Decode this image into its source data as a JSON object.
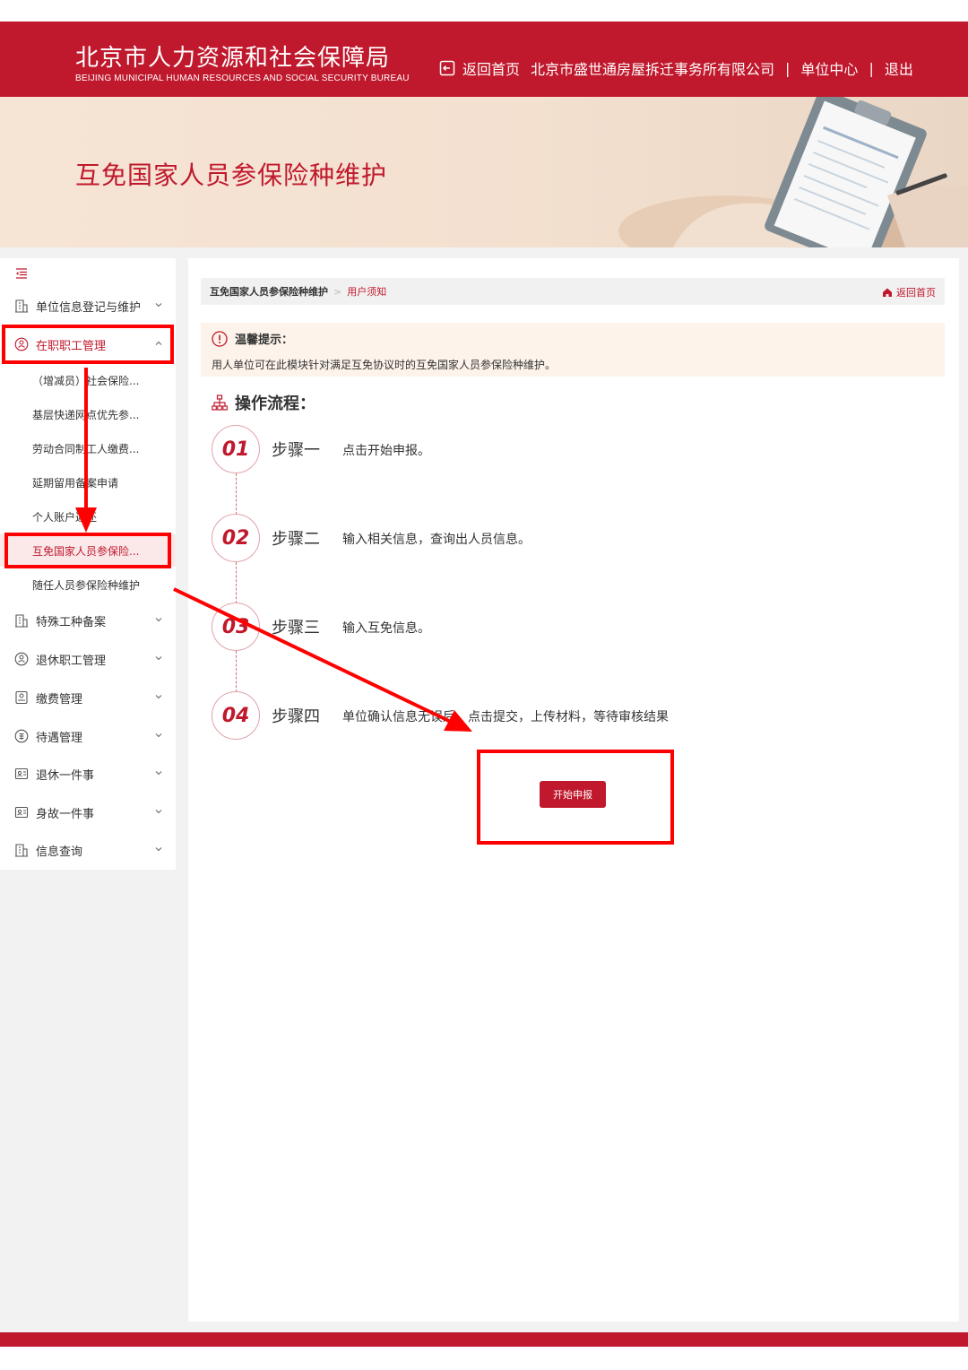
{
  "header": {
    "title": "北京市人力资源和社会保障局",
    "subtitle": "BEIJING MUNICIPAL HUMAN RESOURCES AND SOCIAL SECURITY BUREAU",
    "nav": {
      "home": "返回首页",
      "company": "北京市盛世通房屋拆迁事务所有限公司",
      "separator": "|",
      "unit_center": "单位中心",
      "logout": "退出"
    }
  },
  "banner": {
    "page_title": "互免国家人员参保险种维护"
  },
  "sidebar": {
    "menu": [
      {
        "label": "单位信息登记与维护"
      },
      {
        "label": "在职职工管理"
      },
      {
        "label": "特殊工种备案"
      },
      {
        "label": "退休职工管理"
      },
      {
        "label": "缴费管理"
      },
      {
        "label": "待遇管理"
      },
      {
        "label": "退休一件事"
      },
      {
        "label": "身故一件事"
      },
      {
        "label": "信息查询"
      }
    ],
    "subitems": [
      {
        "label": "（增减员）社会保险..."
      },
      {
        "label": "基层快递网点优先参..."
      },
      {
        "label": "劳动合同制工人缴费..."
      },
      {
        "label": "延期留用备案申请"
      },
      {
        "label": "个人账户返还"
      },
      {
        "label": "互免国家人员参保险..."
      },
      {
        "label": "随任人员参保险种维护"
      }
    ]
  },
  "breadcrumb": {
    "main": "互免国家人员参保险种维护",
    "separator": ">",
    "current": "用户须知",
    "home": "返回首页"
  },
  "notice": {
    "title": "温馨提示：",
    "text": "用人单位可在此模块针对满足互免协议时的互免国家人员参保险种维护。"
  },
  "flow": {
    "title": "操作流程：",
    "steps": [
      {
        "num": "01",
        "name": "步骤一",
        "desc": "点击开始申报。"
      },
      {
        "num": "02",
        "name": "步骤二",
        "desc": "输入相关信息，查询出人员信息。"
      },
      {
        "num": "03",
        "name": "步骤三",
        "desc": "输入互免信息。"
      },
      {
        "num": "04",
        "name": "步骤四",
        "desc": "单位确认信息无误后，点击提交，上传材料，等待审核结果"
      }
    ]
  },
  "start_button": {
    "label": "开始申报"
  },
  "colors": {
    "brand_red": "#c0182c",
    "annotation_red": "#ff0000",
    "notice_bg": "#fdf3ea"
  }
}
